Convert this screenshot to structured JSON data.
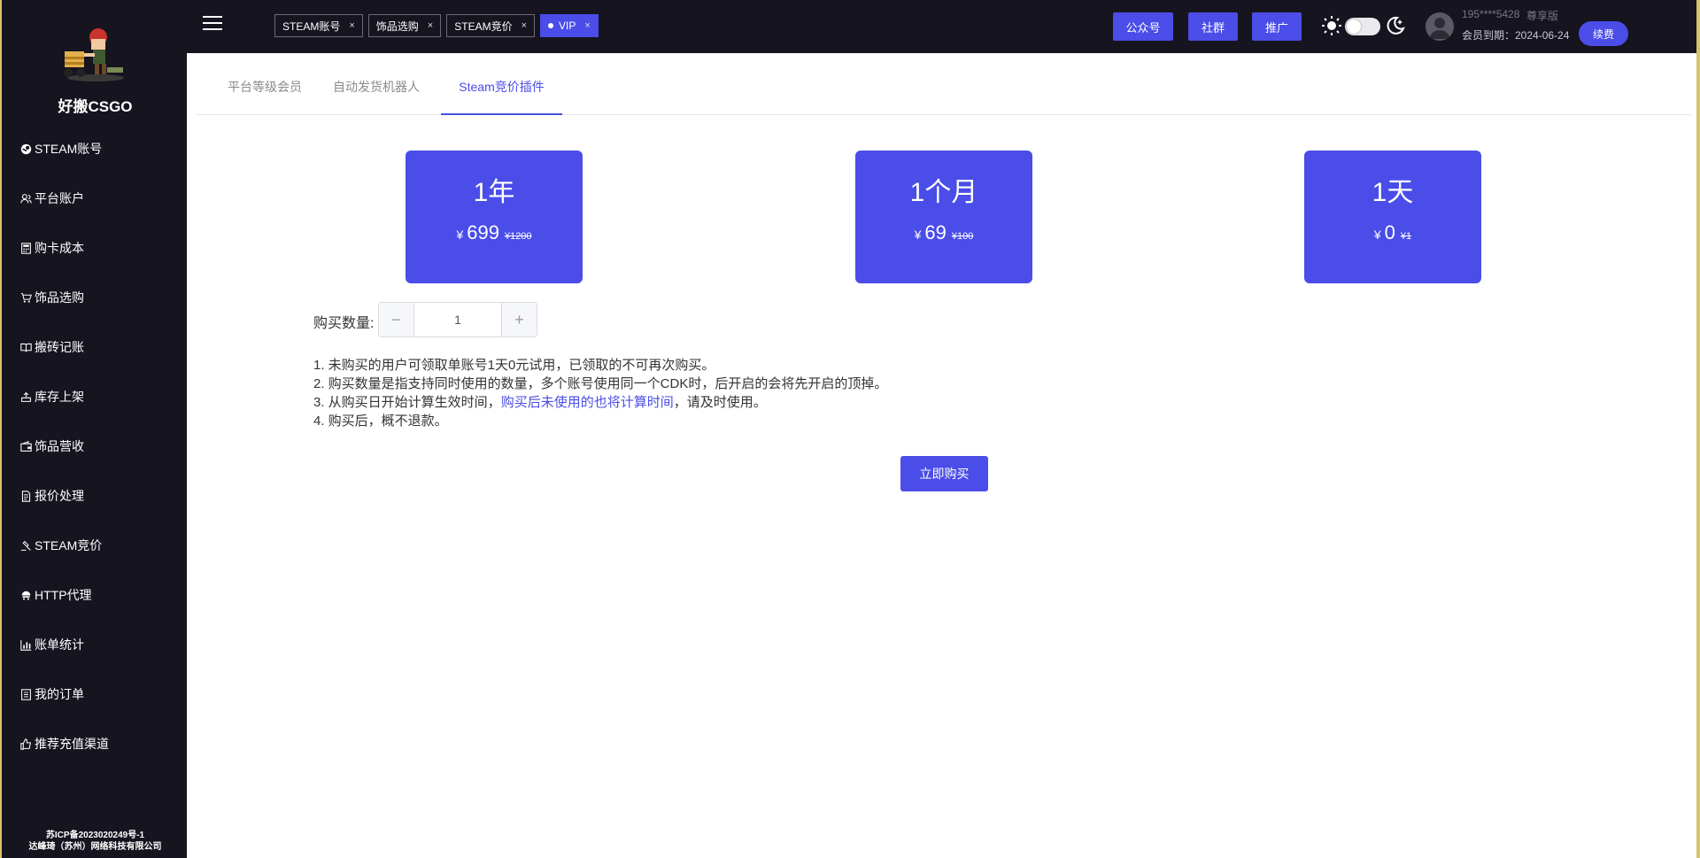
{
  "sidebar": {
    "brand": "好搬CSGO",
    "items": [
      {
        "label": "STEAM账号",
        "icon": "steam-icon"
      },
      {
        "label": "平台账户",
        "icon": "user-icon"
      },
      {
        "label": "购卡成本",
        "icon": "calculator-icon"
      },
      {
        "label": "饰品选购",
        "icon": "cart-icon"
      },
      {
        "label": "搬砖记账",
        "icon": "book-icon"
      },
      {
        "label": "库存上架",
        "icon": "shelf-icon"
      },
      {
        "label": "饰品营收",
        "icon": "wallet-icon"
      },
      {
        "label": "报价处理",
        "icon": "document-icon"
      },
      {
        "label": "STEAM竞价",
        "icon": "gavel-icon"
      },
      {
        "label": "HTTP代理",
        "icon": "proxy-icon"
      },
      {
        "label": "账单统计",
        "icon": "chart-icon"
      },
      {
        "label": "我的订单",
        "icon": "order-icon"
      },
      {
        "label": "推荐充值渠道",
        "icon": "thumbs-up-icon"
      }
    ],
    "footer_line1": "苏ICP备2023020249号-1",
    "footer_line2": "达峰琦（苏州）网络科技有限公司"
  },
  "topbar": {
    "tabs": [
      {
        "label": "STEAM账号",
        "close": "×",
        "active": false
      },
      {
        "label": "饰品选购",
        "close": "×",
        "active": false
      },
      {
        "label": "STEAM竞价",
        "close": "×",
        "active": false
      },
      {
        "label": "VIP",
        "close": "×",
        "active": true
      }
    ],
    "btn_official": "公众号",
    "btn_community": "社群",
    "btn_promote": "推广",
    "user_phone": "195****5428",
    "user_level": "尊享版",
    "user_expire": "会员到期：2024-06-24",
    "renew_label": "续费"
  },
  "main": {
    "subtabs": [
      "平台等级会员",
      "自动发货机器人",
      "Steam竞价插件"
    ],
    "active_subtab": 2,
    "plans": [
      {
        "period": "1年",
        "currency": "¥",
        "price": "699",
        "old_price": "¥1200"
      },
      {
        "period": "1个月",
        "currency": "¥",
        "price": "69",
        "old_price": "¥100"
      },
      {
        "period": "1天",
        "currency": "¥",
        "price": "0",
        "old_price": "¥1"
      }
    ],
    "qty_label": "购买数量:",
    "qty_value": "1",
    "qty_dec": "−",
    "qty_inc": "+",
    "notes": {
      "n1": "1. 未购买的用户可领取单账号1天0元试用，已领取的不可再次购买。",
      "n2": "2. 购买数量是指支持同时使用的数量，多个账号使用同一个CDK时，后开启的会将先开启的顶掉。",
      "n3_prefix": "3. 从购买日开始计算生效时间，",
      "n3_link": "购买后未使用的也将计算时间",
      "n3_suffix": "，请及时使用。",
      "n4": "4. 购买后，概不退款。"
    },
    "buy_label": "立即购买"
  },
  "colors": {
    "accent": "#4a4de7",
    "sidebar_bg": "#15141f",
    "frame": "#d6c36a"
  }
}
